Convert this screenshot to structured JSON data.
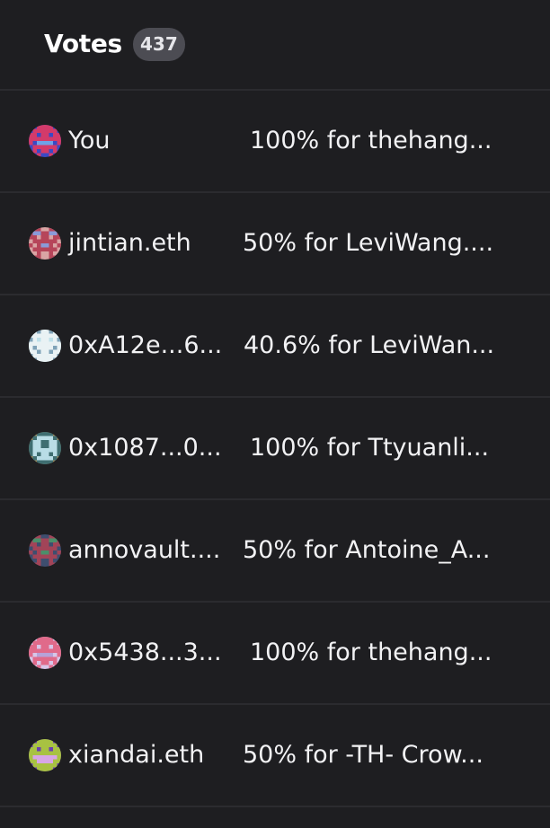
{
  "header": {
    "title": "Votes",
    "count": "437"
  },
  "votes": [
    {
      "voter": "You",
      "choice": "100% for thehang...",
      "avatar": {
        "bg": "#3a49c4",
        "fg": "#d33a6a",
        "accent": "#6fa2e8",
        "pattern": "robot"
      }
    },
    {
      "voter": "jintian.eth",
      "choice": "50% for LeviWang....",
      "avatar": {
        "bg": "#d9a4a4",
        "fg": "#b6455a",
        "accent": "#8a9ad8",
        "pattern": "face"
      }
    },
    {
      "voter": "0xA12e...6...",
      "choice": "40.6% for LeviWan...",
      "avatar": {
        "bg": "#bfe1ea",
        "fg": "#e9f2f4",
        "accent": "#7fa3b8",
        "pattern": "grid"
      }
    },
    {
      "voter": "0x1087...0...",
      "choice": "100% for Ttyuanli...",
      "avatar": {
        "bg": "#9e8e62",
        "fg": "#b9dde6",
        "accent": "#3f6e71",
        "pattern": "window"
      }
    },
    {
      "voter": "annovault....",
      "choice": "50% for Antoine_A...",
      "avatar": {
        "bg": "#3e4e6f",
        "fg": "#a24458",
        "accent": "#4b8f6a",
        "pattern": "face"
      }
    },
    {
      "voter": "0x5438...3...",
      "choice": "100% for thehang...",
      "avatar": {
        "bg": "#d7c6e8",
        "fg": "#e06a8a",
        "accent": "#b7a2d8",
        "pattern": "robot"
      }
    },
    {
      "voter": "xiandai.eth",
      "choice": "50% for -TH- Crow...",
      "avatar": {
        "bg": "#6a3fb0",
        "fg": "#a8c242",
        "accent": "#d7a6e6",
        "pattern": "grin"
      }
    }
  ]
}
